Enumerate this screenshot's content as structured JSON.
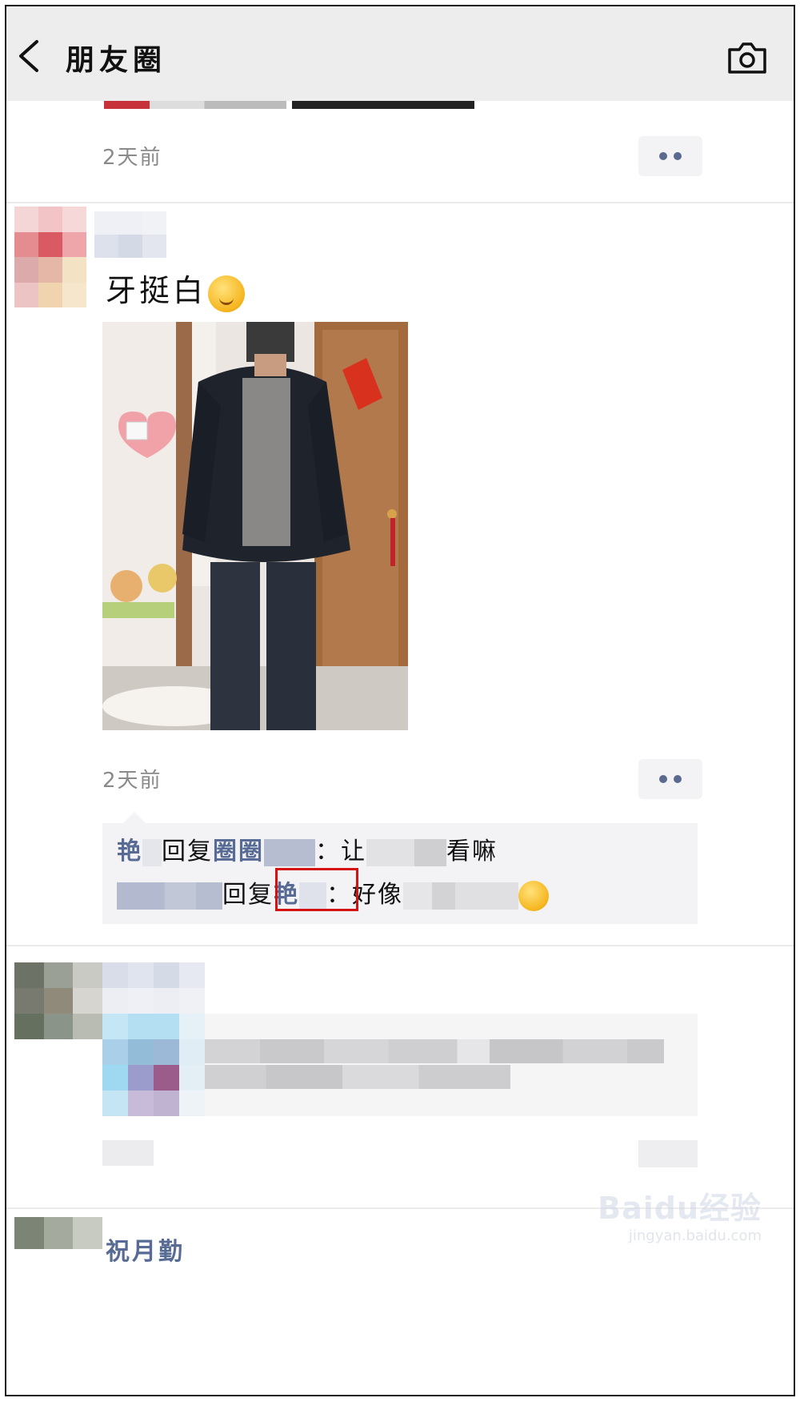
{
  "header": {
    "title": "朋友圈",
    "back_icon": "chevron-left-icon",
    "camera_icon": "camera-icon",
    "background": "#ededed"
  },
  "previous_post": {
    "time": "2天前"
  },
  "post": {
    "text": "牙挺白",
    "emoji": "face-with-hand-over-mouth-emoji",
    "time": "2天前",
    "comments": [
      {
        "author": "艳",
        "verb": "回复",
        "reply_to": "圈圈",
        "separator": "：",
        "text_start": "让",
        "text_end": "看嘛"
      },
      {
        "verb": "回复",
        "reply_to": "艳",
        "separator": "：",
        "text_start": "好像"
      }
    ]
  },
  "next_post": {
    "name": "祝月勤"
  },
  "watermark": {
    "main": "Baidu经验",
    "sub": "jingyan.baidu.com"
  },
  "colors": {
    "nickname": "#576b95",
    "highlight": "#d41212",
    "comment_bg": "#f3f3f5"
  }
}
